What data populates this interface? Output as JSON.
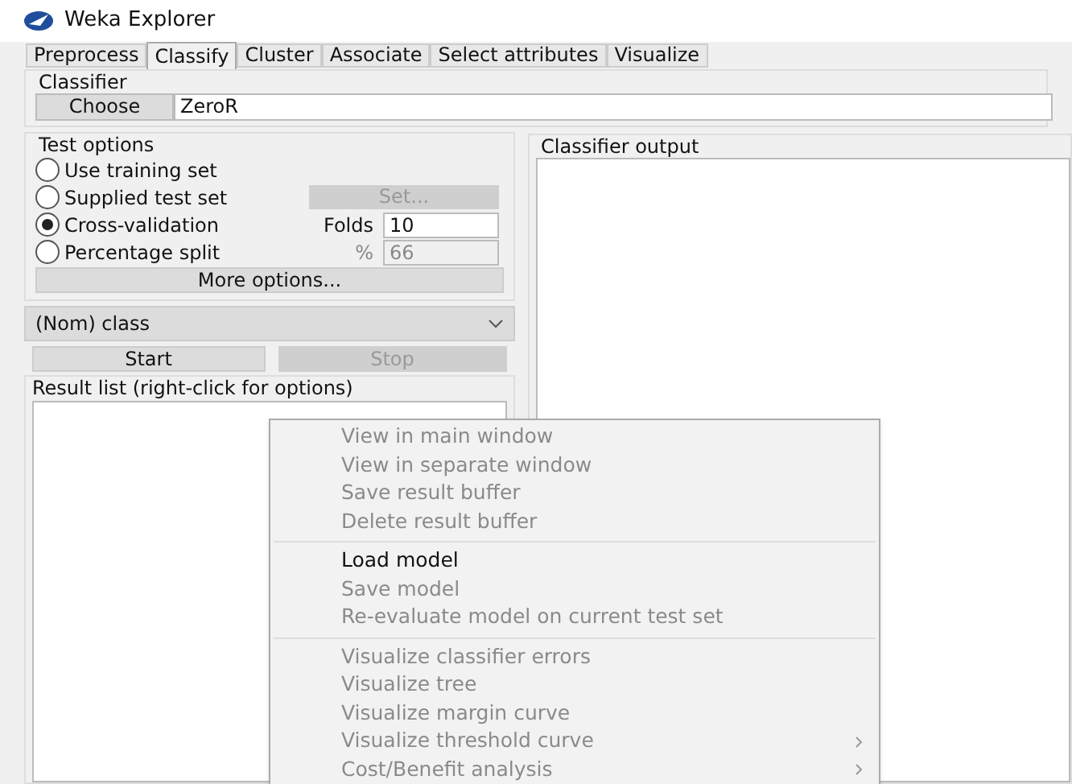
{
  "window": {
    "title": "Weka Explorer"
  },
  "tabs": [
    {
      "label": "Preprocess",
      "selected": false
    },
    {
      "label": "Classify",
      "selected": true
    },
    {
      "label": "Cluster",
      "selected": false
    },
    {
      "label": "Associate",
      "selected": false
    },
    {
      "label": "Select attributes",
      "selected": false
    },
    {
      "label": "Visualize",
      "selected": false
    }
  ],
  "classifier": {
    "title": "Classifier",
    "choose_button": "Choose",
    "value": "ZeroR"
  },
  "test_options": {
    "title": "Test options",
    "options": [
      {
        "label": "Use training set",
        "selected": false
      },
      {
        "label": "Supplied test set",
        "selected": false,
        "side": {
          "kind": "button",
          "value": "Set...",
          "disabled": true
        }
      },
      {
        "label": "Cross-validation",
        "selected": true,
        "side": {
          "kind": "field",
          "label": "Folds",
          "value": "10",
          "disabled": false
        }
      },
      {
        "label": "Percentage split",
        "selected": false,
        "side": {
          "kind": "field",
          "label": "%",
          "value": "66",
          "disabled": true
        }
      }
    ],
    "more_button": "More options..."
  },
  "class_dropdown": {
    "value": "(Nom) class"
  },
  "start_button": {
    "label": "Start",
    "disabled": false
  },
  "stop_button": {
    "label": "Stop",
    "disabled": true
  },
  "result_list": {
    "title": "Result list (right-click for options)"
  },
  "output": {
    "title": "Classifier output"
  },
  "context_menu": {
    "groups": [
      [
        {
          "label": "View in main window",
          "disabled": true,
          "submenu": false
        },
        {
          "label": "View in separate window",
          "disabled": true,
          "submenu": false
        },
        {
          "label": "Save result buffer",
          "disabled": true,
          "submenu": false
        },
        {
          "label": "Delete result buffer",
          "disabled": true,
          "submenu": false
        }
      ],
      [
        {
          "label": "Load model",
          "disabled": false,
          "submenu": false
        },
        {
          "label": "Save model",
          "disabled": true,
          "submenu": false
        },
        {
          "label": "Re-evaluate model on current test set",
          "disabled": true,
          "submenu": false
        }
      ],
      [
        {
          "label": "Visualize classifier errors",
          "disabled": true,
          "submenu": false
        },
        {
          "label": "Visualize tree",
          "disabled": true,
          "submenu": false
        },
        {
          "label": "Visualize margin curve",
          "disabled": true,
          "submenu": false
        },
        {
          "label": "Visualize threshold curve",
          "disabled": true,
          "submenu": true
        },
        {
          "label": "Cost/Benefit analysis",
          "disabled": true,
          "submenu": true
        }
      ]
    ]
  }
}
